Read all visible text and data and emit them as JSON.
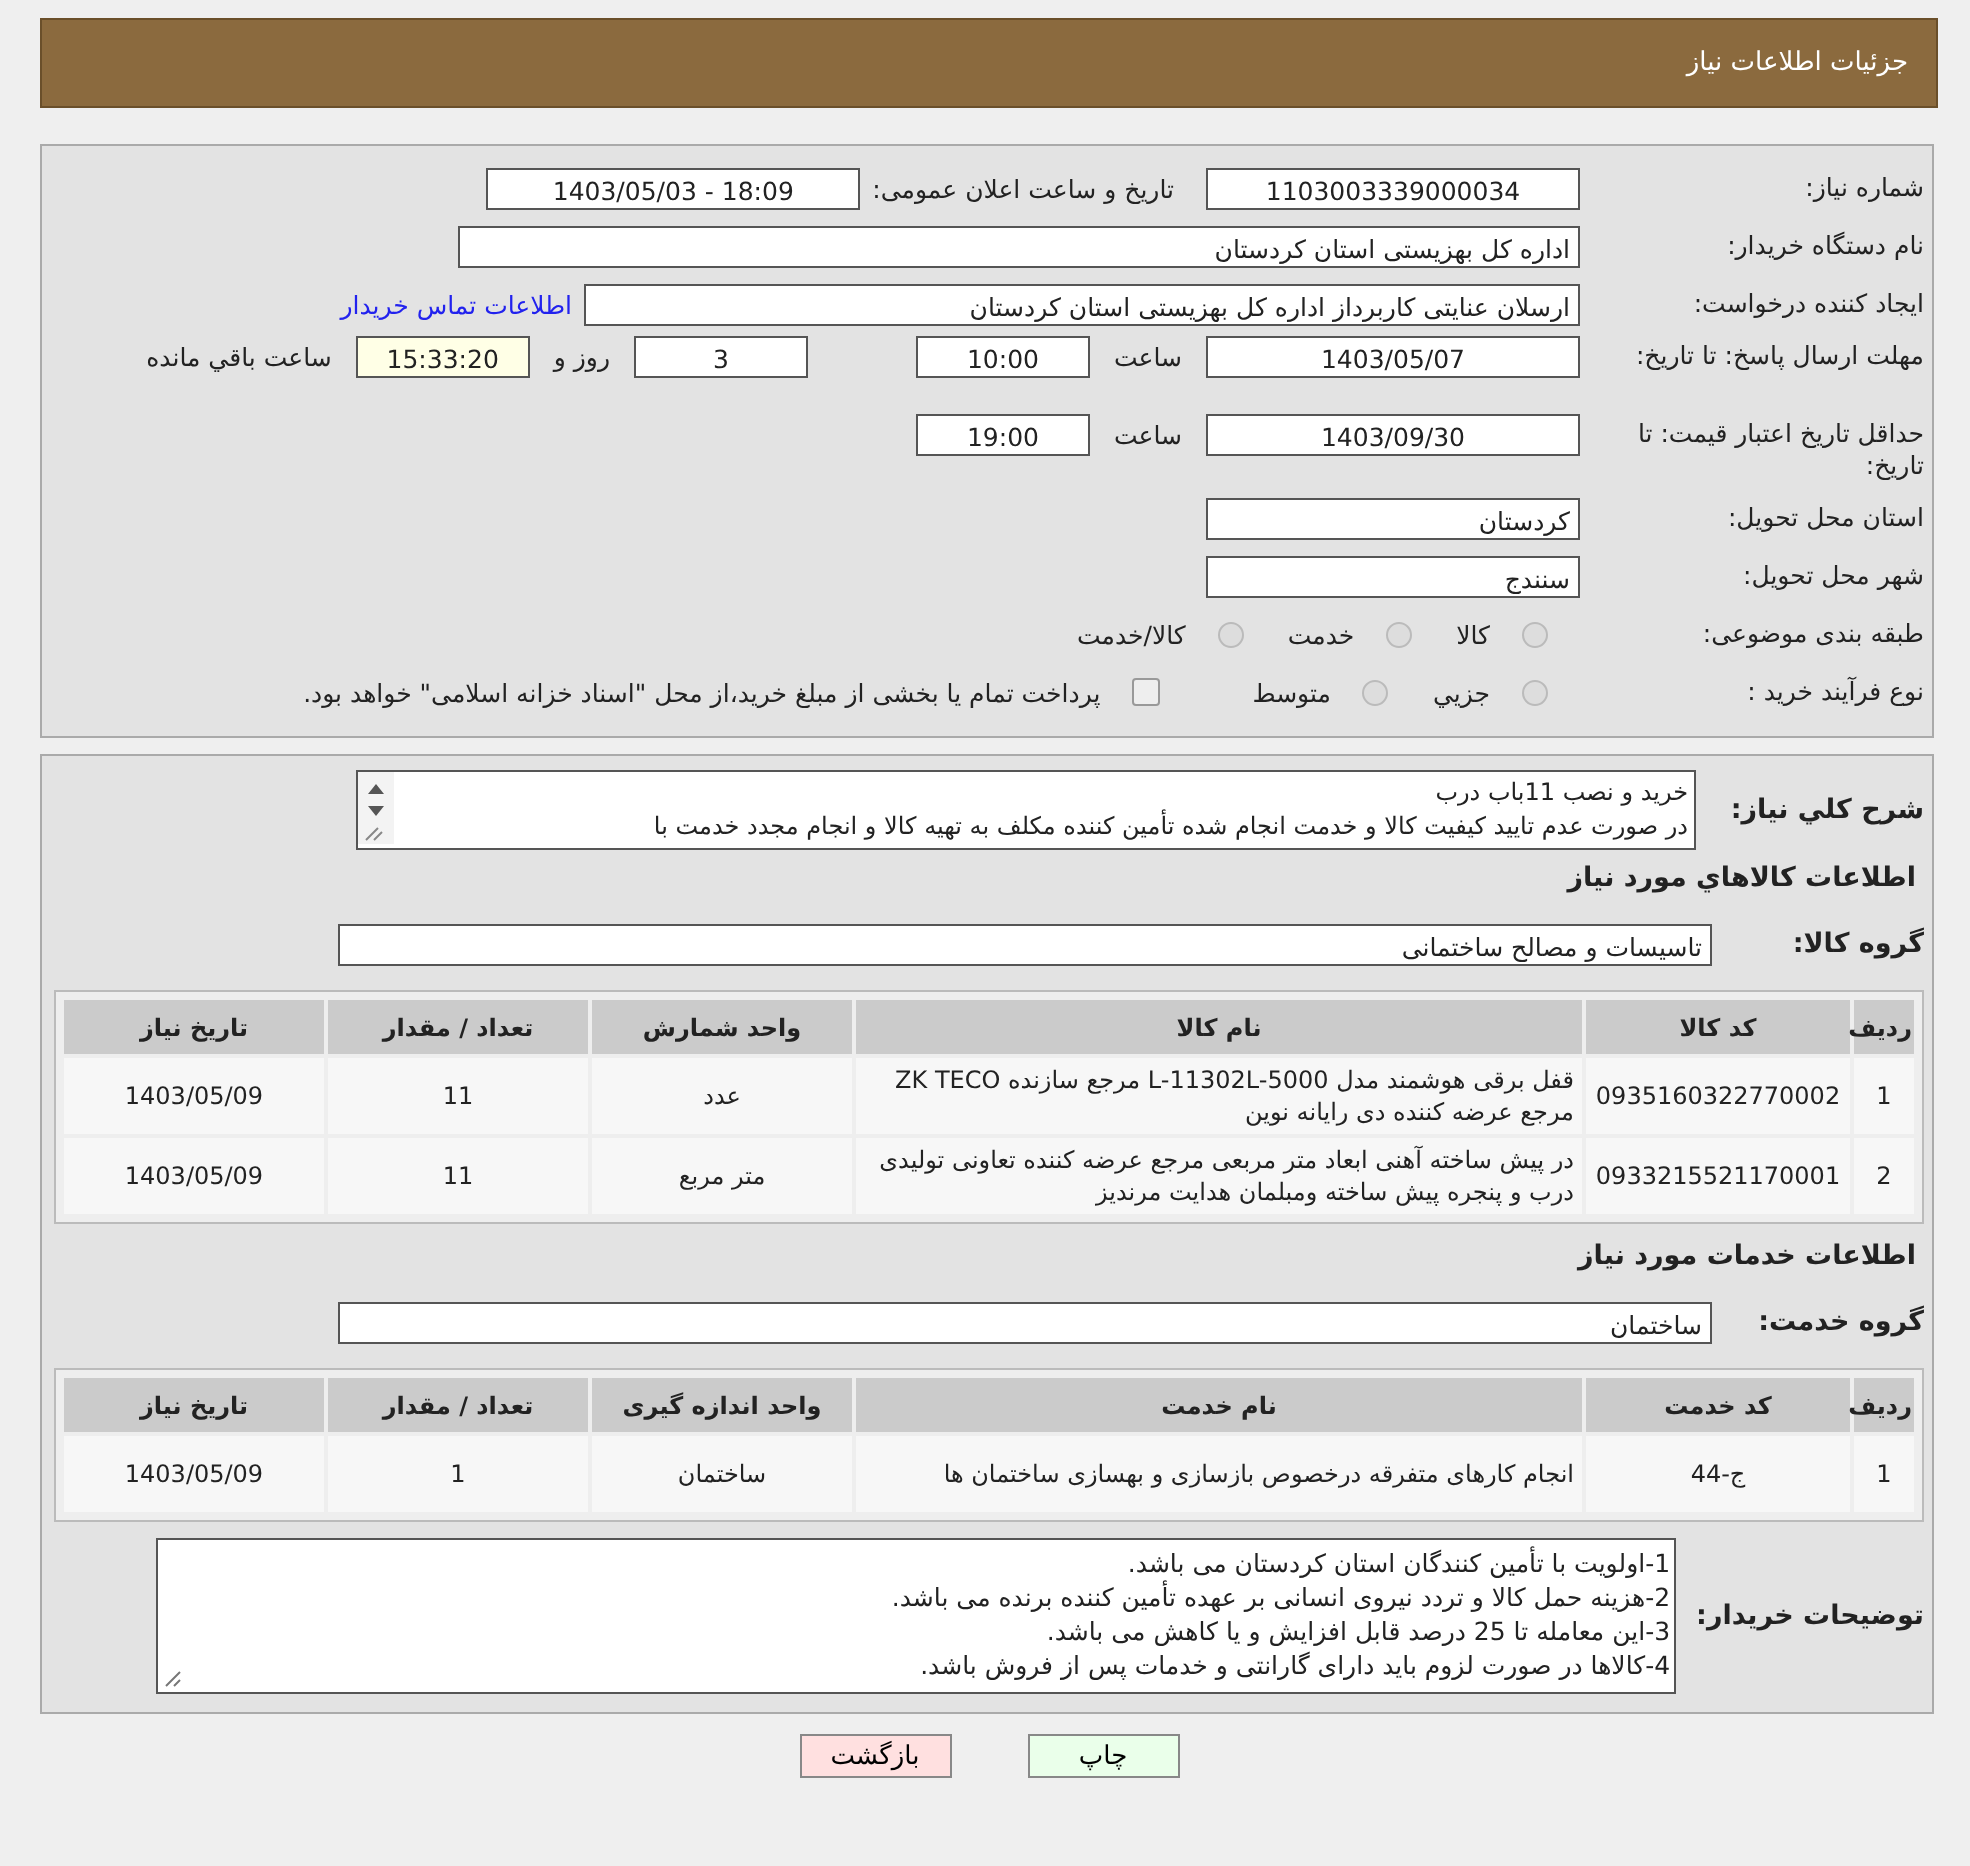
{
  "header": {
    "title": "جزئیات اطلاعات نیاز"
  },
  "details": {
    "need_number": {
      "label": "شماره نیاز:",
      "value": "1103003339000034"
    },
    "announce": {
      "label": "تاریخ و ساعت اعلان عمومی:",
      "value": "1403/05/03 - 18:09"
    },
    "buyer": {
      "label": "نام دستگاه خریدار:",
      "value": "اداره کل بهزیستی استان کردستان"
    },
    "requester": {
      "label": "ایجاد کننده درخواست:",
      "value": "ارسلان  عنایتی کاربرداز اداره کل بهزیستی استان کردستان",
      "link": "اطلاعات تماس خریدار"
    },
    "deadline": {
      "label": "مهلت ارسال پاسخ: تا تاریخ:",
      "date": "1403/05/07",
      "time_label": "ساعت",
      "time": "10:00",
      "days": "3",
      "days_label": "روز و",
      "remaining": "15:33:20",
      "remaining_label": "ساعت باقي مانده"
    },
    "validity": {
      "label": "حداقل تاریخ اعتبار قیمت: تا تاریخ:",
      "date": "1403/09/30",
      "time_label": "ساعت",
      "time": "19:00"
    },
    "province": {
      "label": "استان محل تحویل:",
      "value": "کردستان"
    },
    "city": {
      "label": "شهر محل تحویل:",
      "value": "سنندج"
    },
    "category": {
      "label": "طبقه بندی موضوعی:",
      "options": [
        {
          "label": "کالا",
          "selected": false
        },
        {
          "label": "خدمت",
          "selected": false
        },
        {
          "label": "کالا/خدمت",
          "selected": false
        }
      ]
    },
    "process": {
      "label": "نوع فرآیند خرید :",
      "options": [
        {
          "label": "جزيي",
          "selected": false
        },
        {
          "label": "متوسط",
          "selected": false
        }
      ],
      "payment": {
        "checked": false,
        "text": "پرداخت تمام یا بخشی از مبلغ خرید،از محل \"اسناد خزانه اسلامی\" خواهد بود."
      }
    }
  },
  "description": {
    "label": "شرح کلي نياز:",
    "lines": [
      "خرید و نصب 11باب درب",
      "در صورت عدم تایید کیفیت کالا و خدمت انجام شده تأمین کننده مکلف به تهیه کالا و انجام مجدد خدمت با"
    ]
  },
  "goods": {
    "heading": "اطلاعات کالاهاي مورد نياز",
    "group_label": "گروه کالا:",
    "group": "تاسیسات و مصالح ساختمانی",
    "columns": [
      "ردیف",
      "کد کالا",
      "نام کالا",
      "واحد شمارش",
      "تعداد / مقدار",
      "تاریخ نیاز"
    ],
    "rows": [
      [
        "1",
        "0935160322770002",
        "قفل برقی هوشمند مدل L-11302L-5000 مرجع سازنده ZK TECO مرجع عرضه کننده دی رایانه نوین",
        "عدد",
        "11",
        "1403/05/09"
      ],
      [
        "2",
        "0933215521170001",
        "در پیش ساخته آهنی ابعاد متر مربعی مرجع عرضه کننده تعاونی تولیدی درب و پنجره پیش ساخته ومبلمان هدایت مرندیز",
        "متر مربع",
        "11",
        "1403/05/09"
      ]
    ]
  },
  "services": {
    "heading": "اطلاعات خدمات مورد نياز",
    "group_label": "گروه خدمت:",
    "group": "ساختمان",
    "columns": [
      "ردیف",
      "کد خدمت",
      "نام خدمت",
      "واحد اندازه گیری",
      "تعداد / مقدار",
      "تاریخ نیاز"
    ],
    "rows": [
      [
        "1",
        "ج-44",
        "انجام کارهای متفرقه درخصوص بازسازی و بهسازی ساختمان ها",
        "ساختمان",
        "1",
        "1403/05/09"
      ]
    ]
  },
  "notes": {
    "label": "توضیحات خریدار:",
    "lines": [
      "1-اولویت با تأمین کنندگان استان کردستان می باشد.",
      "2-هزینه حمل کالا و تردد نیروی انسانی بر عهده تأمین کننده برنده می باشد.",
      "3-این معامله تا 25 درصد قابل افزایش و یا کاهش می باشد.",
      "4-کالاها در صورت لزوم باید دارای گارانتی و خدمات پس از فروش باشد."
    ]
  },
  "buttons": [
    {
      "kind": "print",
      "label": "چاپ"
    },
    {
      "kind": "back",
      "label": "بازگشت"
    }
  ]
}
